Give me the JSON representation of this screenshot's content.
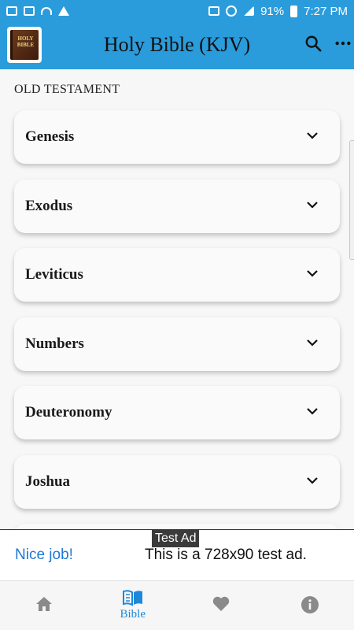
{
  "status_bar": {
    "battery": "91%",
    "time": "7:27 PM"
  },
  "app_bar": {
    "title": "Holy Bible (KJV)",
    "logo_text": "HOLY BIBLE",
    "icons": [
      "search-icon",
      "more-vertical-icon"
    ]
  },
  "section": {
    "label": "OLD TESTAMENT"
  },
  "books": [
    {
      "name": "Genesis"
    },
    {
      "name": "Exodus"
    },
    {
      "name": "Leviticus"
    },
    {
      "name": "Numbers"
    },
    {
      "name": "Deuteronomy"
    },
    {
      "name": "Joshua"
    },
    {
      "name": ""
    }
  ],
  "ad": {
    "tag": "Test Ad",
    "headline": "Nice job!",
    "body": "This is a 728x90 test ad."
  },
  "bottom_nav": {
    "items": [
      {
        "icon": "home-icon",
        "label": ""
      },
      {
        "icon": "book-icon",
        "label": "Bible",
        "active": true
      },
      {
        "icon": "heart-icon",
        "label": ""
      },
      {
        "icon": "info-icon",
        "label": ""
      }
    ]
  },
  "colors": {
    "primary": "#2a9cdc",
    "accent": "#1e88d8",
    "nav_inactive": "#8a8a8a"
  }
}
